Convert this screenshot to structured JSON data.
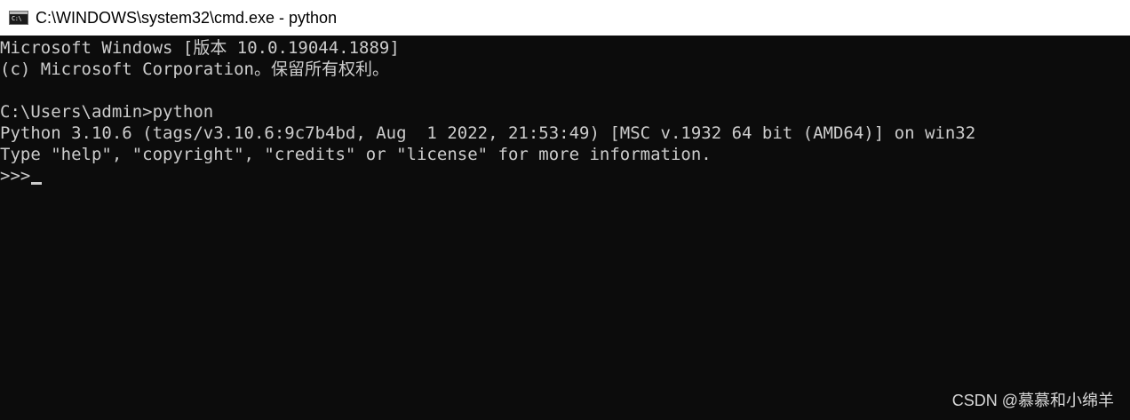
{
  "window": {
    "title": "C:\\WINDOWS\\system32\\cmd.exe - python",
    "icon": "cmd-icon",
    "icon_glyph": "C:\\",
    "colors": {
      "titlebar_bg": "#ffffff",
      "console_bg": "#0c0c0c",
      "console_text": "#cccccc"
    }
  },
  "console": {
    "lines": [
      "Microsoft Windows [版本 10.0.19044.1889]",
      "(c) Microsoft Corporation。保留所有权利。",
      "",
      "C:\\Users\\admin>python",
      "Python 3.10.6 (tags/v3.10.6:9c7b4bd, Aug  1 2022, 21:53:49) [MSC v.1932 64 bit (AMD64)] on win32",
      "Type \"help\", \"copyright\", \"credits\" or \"license\" for more information."
    ],
    "prompt": ">>>"
  },
  "watermark": {
    "text": "CSDN @慕慕和小绵羊"
  }
}
